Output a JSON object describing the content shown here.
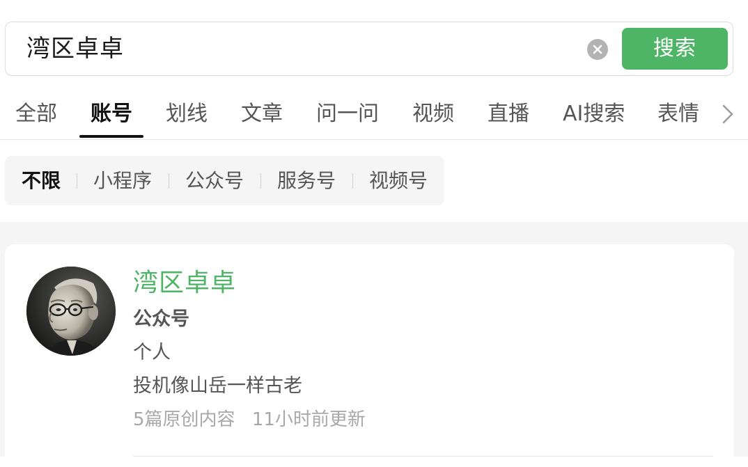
{
  "search": {
    "query": "湾区卓卓",
    "button_label": "搜索"
  },
  "tabs": [
    {
      "label": "全部",
      "active": false
    },
    {
      "label": "账号",
      "active": true
    },
    {
      "label": "划线",
      "active": false
    },
    {
      "label": "文章",
      "active": false
    },
    {
      "label": "问一问",
      "active": false
    },
    {
      "label": "视频",
      "active": false
    },
    {
      "label": "直播",
      "active": false
    },
    {
      "label": "AI搜索",
      "active": false
    },
    {
      "label": "表情",
      "active": false
    }
  ],
  "filters": [
    {
      "label": "不限",
      "active": true
    },
    {
      "label": "小程序",
      "active": false
    },
    {
      "label": "公众号",
      "active": false
    },
    {
      "label": "服务号",
      "active": false
    },
    {
      "label": "视频号",
      "active": false
    }
  ],
  "result": {
    "name": "湾区卓卓",
    "type": "公众号",
    "verification": "个人",
    "description": "投机像山岳一样古老",
    "original_count": "5篇原创内容",
    "updated": "11小时前更新"
  },
  "colors": {
    "accent_green": "#4fb566",
    "text_primary": "#1a1a1a",
    "text_secondary": "#555555",
    "text_muted": "#a8a8a8",
    "background_gray": "#f5f5f5"
  },
  "icons": {
    "clear": "clear-icon",
    "more_tabs": "chevron-right-icon"
  }
}
